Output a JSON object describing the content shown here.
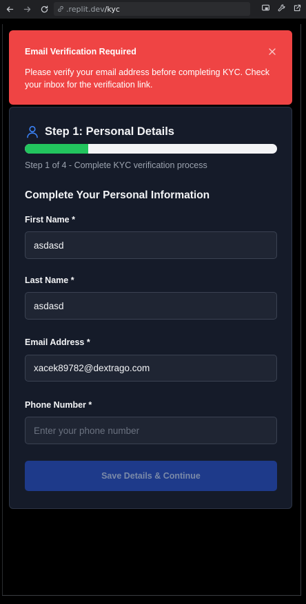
{
  "browser": {
    "url_host": ".replit.dev",
    "url_path": "/kyc"
  },
  "alert": {
    "title": "Email Verification Required",
    "message": "Please verify your email address before completing KYC. Check your inbox for the verification link.",
    "close_icon": "close-icon"
  },
  "card": {
    "icon": "user-icon",
    "title": "Step 1: Personal Details",
    "progress": 0.25,
    "progress_color": "#22c55e",
    "subtitle": "Step 1 of 4 - Complete KYC verification process",
    "section_title": "Complete Your Personal Information"
  },
  "form": {
    "first_name": {
      "label": "First Name *",
      "value": "asdasd",
      "placeholder": ""
    },
    "last_name": {
      "label": "Last Name *",
      "value": "asdasd",
      "placeholder": ""
    },
    "email": {
      "label": "Email Address *",
      "value": "xacek89782@dextrago.com",
      "placeholder": ""
    },
    "phone": {
      "label": "Phone Number *",
      "value": "",
      "placeholder": "Enter your phone number"
    },
    "submit_label": "Save Details & Continue"
  },
  "colors": {
    "alert_bg": "#ef4444",
    "card_bg": "#151b29",
    "button_bg": "#1e3a8a",
    "accent": "#3b82f6"
  }
}
